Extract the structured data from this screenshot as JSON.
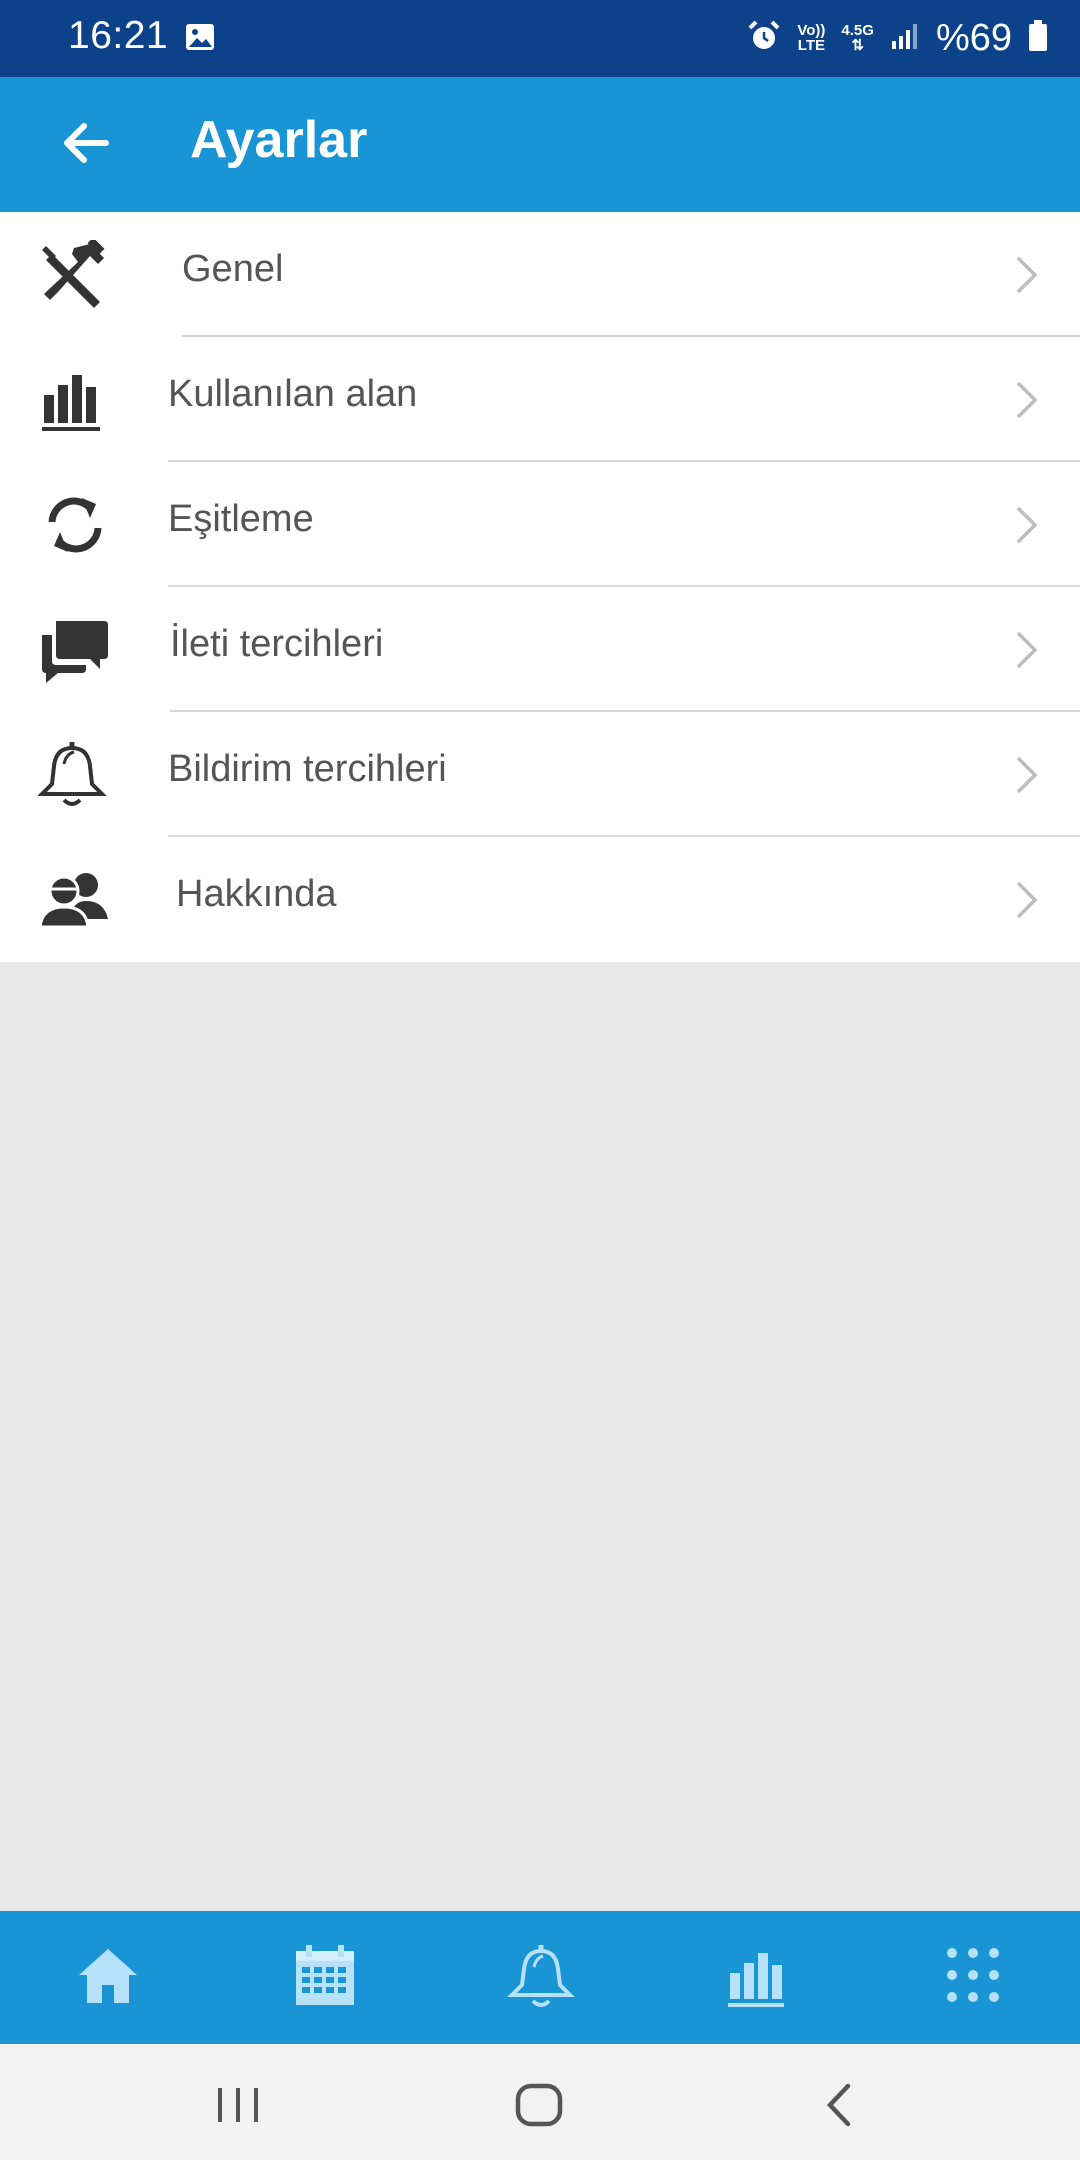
{
  "status_bar": {
    "time": "16:21",
    "network_top": "Vo))",
    "network_bottom": "LTE",
    "speed": "4.5G",
    "battery": "%69"
  },
  "app_bar": {
    "title": "Ayarlar",
    "back_icon": "arrow-left-icon"
  },
  "settings": [
    {
      "label": "Genel",
      "icon": "tools-icon"
    },
    {
      "label": "Kullanılan alan",
      "icon": "bar-chart-icon"
    },
    {
      "label": "Eşitleme",
      "icon": "sync-icon"
    },
    {
      "label": "İleti tercihleri",
      "icon": "chat-icon"
    },
    {
      "label": "Bildirim tercihleri",
      "icon": "bell-icon"
    },
    {
      "label": "Hakkında",
      "icon": "users-icon"
    }
  ],
  "bottom_nav": [
    {
      "icon": "home-icon"
    },
    {
      "icon": "calendar-icon"
    },
    {
      "icon": "bell-icon"
    },
    {
      "icon": "bar-chart-icon"
    },
    {
      "icon": "grid-menu-icon"
    }
  ],
  "colors": {
    "status_bar": "#0b428a",
    "app_bar": "#1994d4",
    "bottom_nav_icon": "#b5e2f8",
    "background": "#e8e8e9"
  }
}
